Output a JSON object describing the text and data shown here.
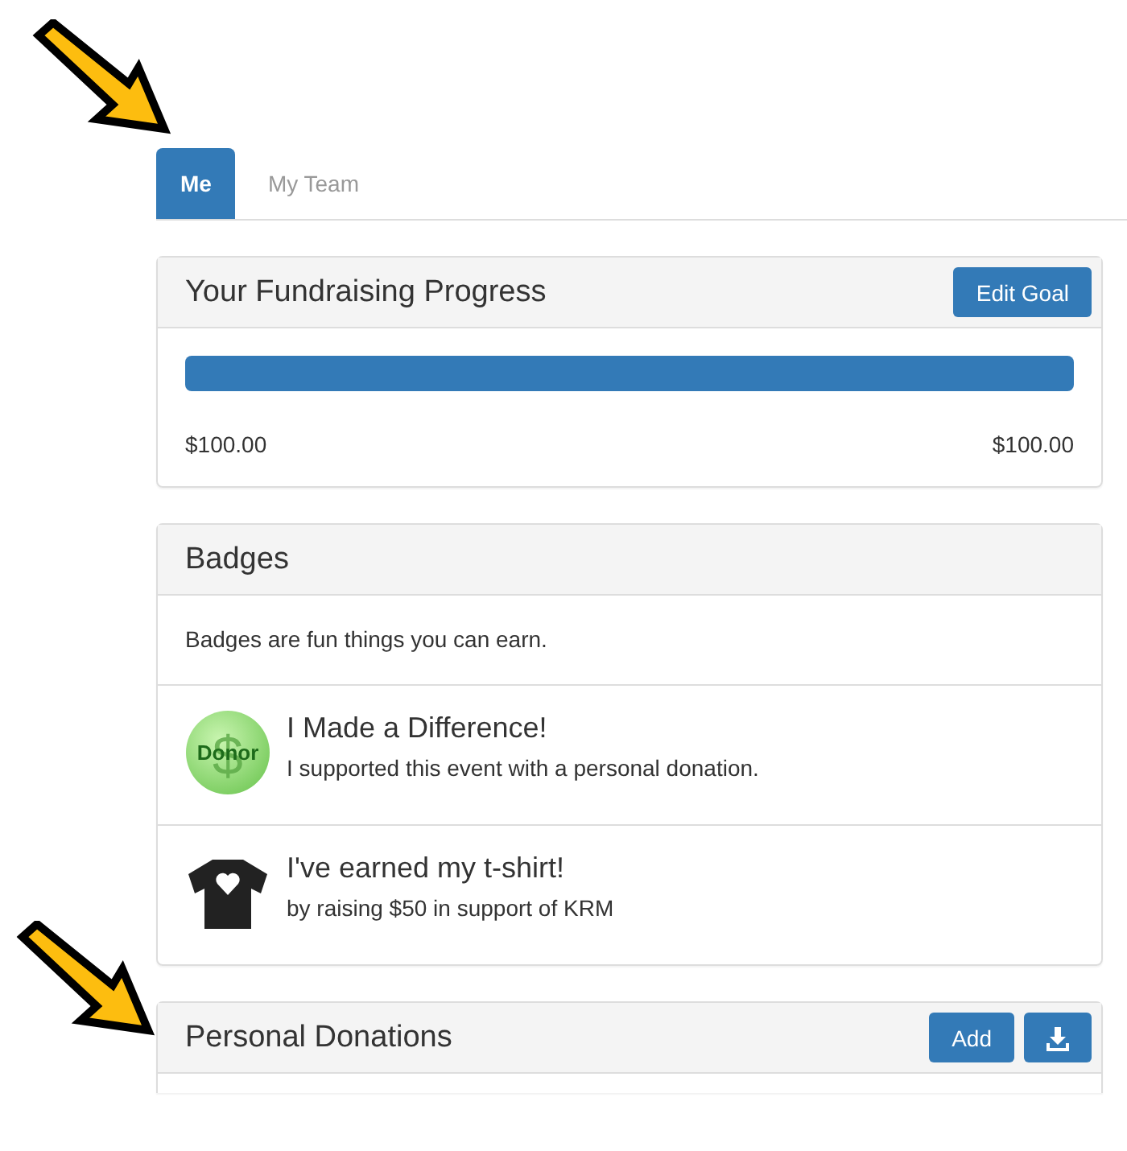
{
  "tabs": [
    {
      "label": "Me",
      "selected": true
    },
    {
      "label": "My Team",
      "selected": false
    }
  ],
  "progress_panel": {
    "title": "Your Fundraising Progress",
    "button": "Edit Goal",
    "level": 1,
    "raised": "$100.00",
    "goal": "$100.00"
  },
  "badges_panel": {
    "title": "Badges",
    "intro": "Badges are fun things you can earn.",
    "badges": [
      {
        "kind": "donor",
        "icon_text": "Donor",
        "icon_symbol": "$",
        "title": "I Made a Difference!",
        "description": "I supported this event with a personal donation."
      },
      {
        "kind": "tshirt",
        "title": "I've earned my t-shirt!",
        "description": "by raising $50 in support of KRM"
      }
    ]
  },
  "donations_panel": {
    "title": "Personal Donations",
    "add_button": "Add"
  }
}
